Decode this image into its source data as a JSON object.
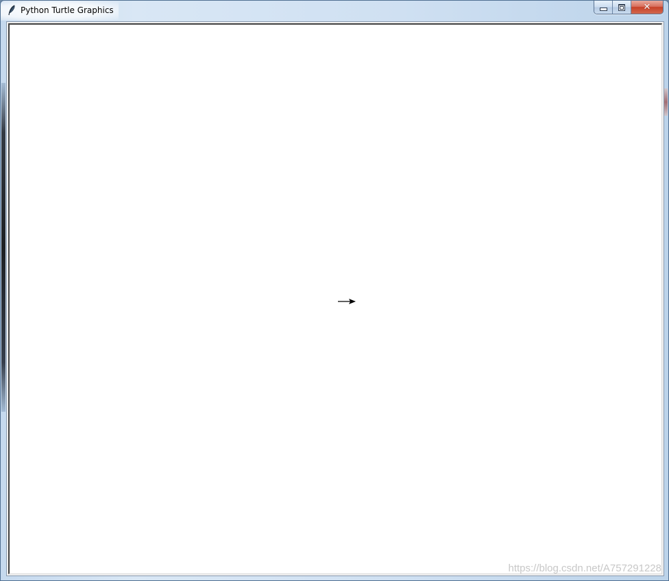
{
  "window": {
    "title": "Python Turtle Graphics"
  },
  "icons": {
    "app": "feather-icon",
    "minimize": "minimize-icon",
    "maximize": "maximize-icon",
    "close": "close-icon",
    "turtle": "arrow-right-icon"
  },
  "colors": {
    "close_button": "#c74128",
    "canvas_background": "#ffffff",
    "turtle": "#000000"
  },
  "watermark": {
    "text": "https://blog.csdn.net/A757291228"
  }
}
